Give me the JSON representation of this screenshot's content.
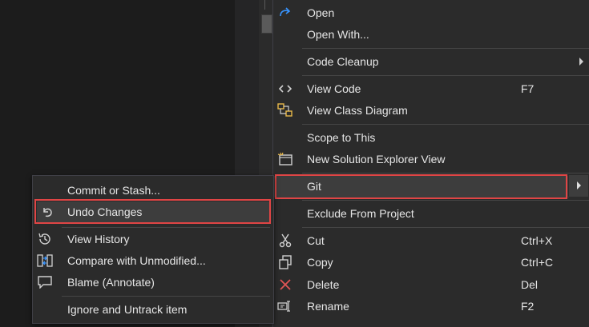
{
  "main_menu": {
    "items": [
      {
        "label": "Open",
        "icon": "redo-arrow-icon"
      },
      {
        "label": "Open With...",
        "icon": ""
      },
      {
        "label": "Code Cleanup",
        "icon": "",
        "submenu": true
      },
      {
        "label": "View Code",
        "shortcut": "F7",
        "icon": "code-brackets-icon"
      },
      {
        "label": "View Class Diagram",
        "icon": "class-diagram-icon"
      },
      {
        "label": "Scope to This",
        "icon": ""
      },
      {
        "label": "New Solution Explorer View",
        "icon": "solution-explorer-view-icon"
      },
      {
        "label": "Git",
        "icon": "",
        "submenu": true,
        "highlighted": true
      },
      {
        "label": "Exclude From Project",
        "icon": ""
      },
      {
        "label": "Cut",
        "shortcut": "Ctrl+X",
        "icon": "scissors-icon"
      },
      {
        "label": "Copy",
        "shortcut": "Ctrl+C",
        "icon": "copy-icon"
      },
      {
        "label": "Delete",
        "shortcut": "Del",
        "icon": "delete-x-icon"
      },
      {
        "label": "Rename",
        "shortcut": "F2",
        "icon": "rename-icon"
      }
    ]
  },
  "git_submenu": {
    "items": [
      {
        "label": "Commit or Stash...",
        "icon": ""
      },
      {
        "label": "Undo Changes",
        "icon": "undo-icon",
        "highlighted": true
      },
      {
        "label": "View History",
        "icon": "history-icon"
      },
      {
        "label": "Compare with Unmodified...",
        "icon": "compare-icon"
      },
      {
        "label": "Blame (Annotate)",
        "icon": "comment-icon"
      },
      {
        "label": "Ignore and Untrack item",
        "icon": ""
      }
    ]
  },
  "colors": {
    "menu_bg": "#2b2b2b",
    "hover_bg": "#3d3d3d",
    "highlight_border": "#e04545",
    "text": "#e6e6e6",
    "accent_blue": "#3794ff",
    "delete_red": "#e05555"
  }
}
